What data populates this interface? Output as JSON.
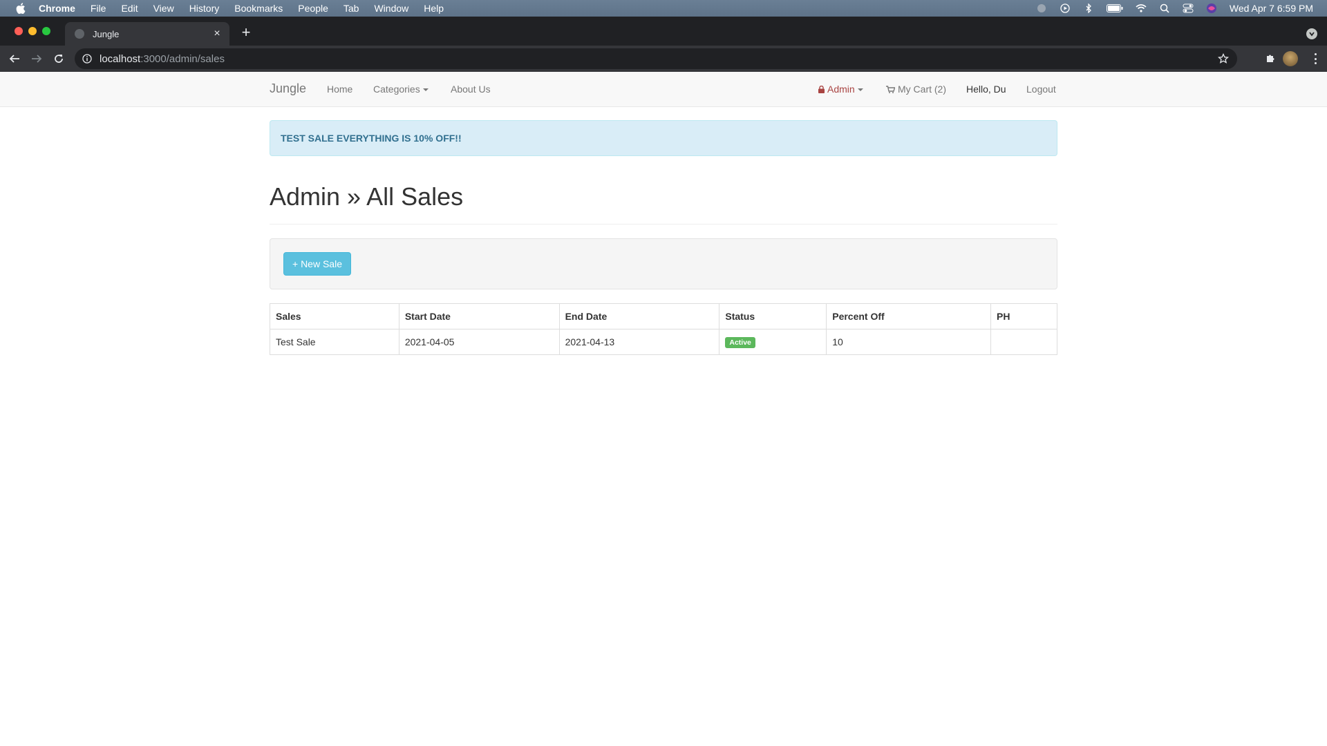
{
  "menubar": {
    "app_name": "Chrome",
    "items": [
      "File",
      "Edit",
      "View",
      "History",
      "Bookmarks",
      "People",
      "Tab",
      "Window",
      "Help"
    ],
    "clock": "Wed Apr 7  6:59 PM"
  },
  "browser": {
    "tab_title": "Jungle",
    "tab_close": "×",
    "new_tab": "+",
    "url_host": "localhost",
    "url_rest": ":3000/admin/sales"
  },
  "navbar": {
    "brand": "Jungle",
    "home": "Home",
    "categories": "Categories",
    "about": "About Us",
    "admin": "Admin",
    "cart": "My Cart (2)",
    "hello": "Hello, Du",
    "logout": "Logout"
  },
  "alert": {
    "text": "TEST SALE EVERYTHING IS 10% OFF!!"
  },
  "page": {
    "title": "Admin » All Sales"
  },
  "actions": {
    "new_sale": "+ New Sale"
  },
  "table": {
    "headers": [
      "Sales",
      "Start Date",
      "End Date",
      "Status",
      "Percent Off",
      "PH"
    ],
    "rows": [
      {
        "sales": "Test Sale",
        "start": "2021-04-05",
        "end": "2021-04-13",
        "status": "Active",
        "percent": "10",
        "ph": ""
      }
    ]
  },
  "colors": {
    "alert_bg": "#d9edf7",
    "alert_text": "#31708f",
    "btn_info": "#5bc0de",
    "label_success": "#5cb85c",
    "admin_red": "#a94442"
  }
}
